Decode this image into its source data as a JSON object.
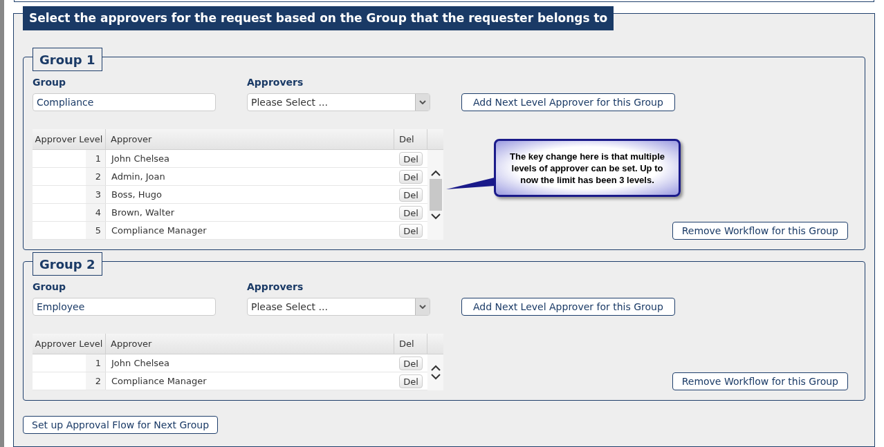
{
  "banner": "Select the approvers for the request based on the Group that the requester belongs to",
  "groups": [
    {
      "legend": "Group 1",
      "group_label": "Group",
      "group_value": "Compliance",
      "approvers_label": "Approvers",
      "approvers_value": "Please Select ...",
      "add_button": "Add Next Level Approver for this Group",
      "columns": [
        "Approver Level",
        "Approver",
        "Del"
      ],
      "rows": [
        {
          "level": "1",
          "approver": "John Chelsea",
          "del": "Del"
        },
        {
          "level": "2",
          "approver": "Admin, Joan",
          "del": "Del"
        },
        {
          "level": "3",
          "approver": "Boss, Hugo",
          "del": "Del"
        },
        {
          "level": "4",
          "approver": "Brown, Walter",
          "del": "Del"
        },
        {
          "level": "5",
          "approver": "Compliance Manager",
          "del": "Del"
        }
      ],
      "callout": "The key change here is that multiple levels of approver can be set. Up to now the limit has been 3 levels.",
      "remove_button": "Remove Workflow for this Group"
    },
    {
      "legend": "Group 2",
      "group_label": "Group",
      "group_value": "Employee",
      "approvers_label": "Approvers",
      "approvers_value": "Please Select ...",
      "add_button": "Add Next Level Approver for this Group",
      "columns": [
        "Approver Level",
        "Approver",
        "Del"
      ],
      "rows": [
        {
          "level": "1",
          "approver": "John Chelsea",
          "del": "Del"
        },
        {
          "level": "2",
          "approver": "Compliance Manager",
          "del": "Del"
        }
      ],
      "remove_button": "Remove Workflow for this Group"
    }
  ],
  "next_group_button": "Set up Approval Flow for Next Group"
}
